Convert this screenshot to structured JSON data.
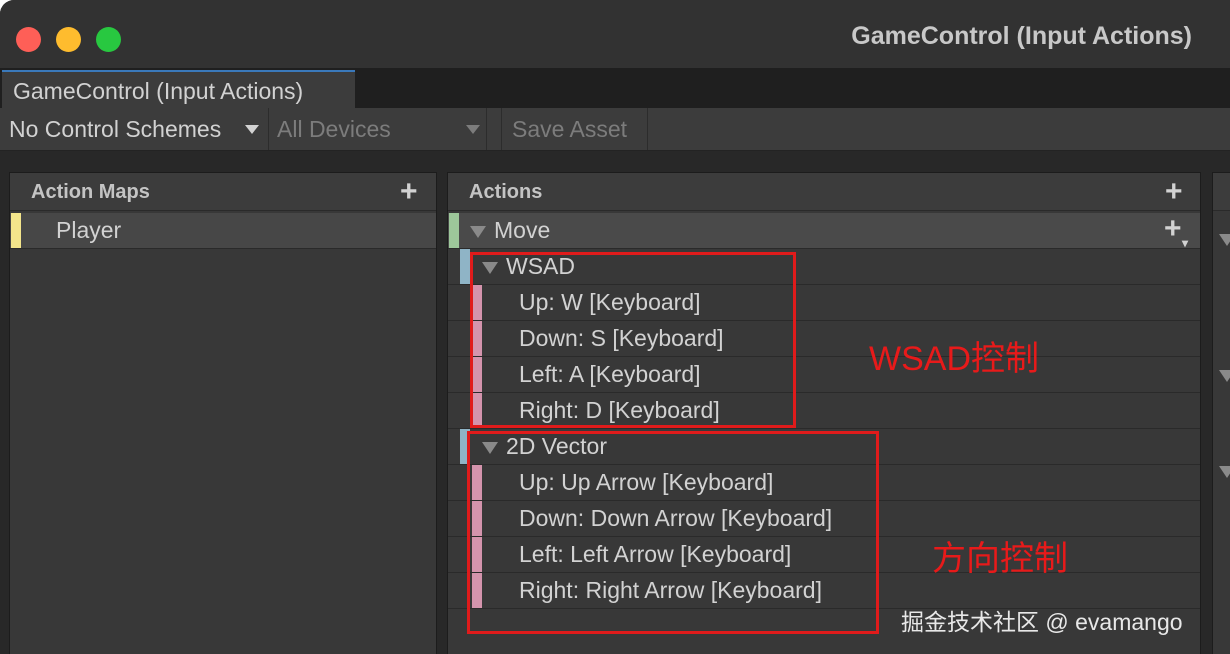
{
  "window": {
    "title": "GameControl (Input Actions)"
  },
  "tab": {
    "label": "GameControl (Input Actions)"
  },
  "toolbar": {
    "control_schemes": "No Control Schemes",
    "devices": "All Devices",
    "save_asset": "Save Asset"
  },
  "action_maps": {
    "header": "Action Maps",
    "add_symbol": "+",
    "items": [
      {
        "label": "Player"
      }
    ]
  },
  "actions": {
    "header": "Actions",
    "add_symbol": "+",
    "move": {
      "label": "Move",
      "composites": [
        {
          "label": "WSAD",
          "bindings": [
            "Up: W [Keyboard]",
            "Down: S [Keyboard]",
            "Left: A [Keyboard]",
            "Right: D [Keyboard]"
          ]
        },
        {
          "label": "2D Vector",
          "bindings": [
            "Up: Up Arrow [Keyboard]",
            "Down: Down Arrow [Keyboard]",
            "Left: Left Arrow [Keyboard]",
            "Right: Right Arrow [Keyboard]"
          ]
        }
      ]
    }
  },
  "annotations": {
    "wsad": "WSAD控制",
    "arrows": "方向控制"
  },
  "watermark": "掘金技术社区 @ evamango",
  "colors": {
    "action_map_accent": "#f3e58b",
    "action_accent": "#9dc79a",
    "composite_accent": "#8fb4c6",
    "binding_accent": "#d494ad",
    "annotation_red": "#e01b1b"
  }
}
